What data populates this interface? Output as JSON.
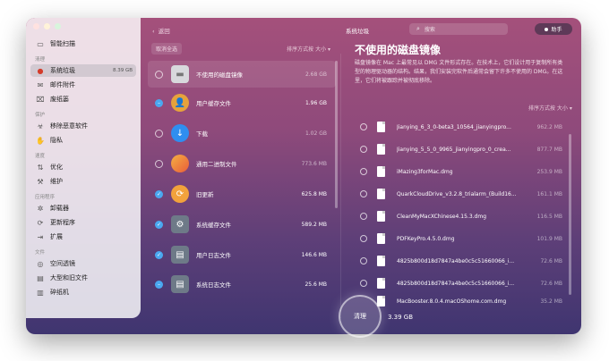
{
  "window": {
    "title": "系统垃圾",
    "back_label": "返回"
  },
  "search": {
    "placeholder": "搜索"
  },
  "assistant": {
    "label": "助手"
  },
  "sidebar": {
    "top_item": {
      "label": "智能扫描",
      "icon": "monitor-icon"
    },
    "sections": [
      {
        "label": "清理",
        "items": [
          {
            "label": "系统垃圾",
            "icon": "system-junk-icon",
            "size": "8.39 GB",
            "active": true
          },
          {
            "label": "邮件附件",
            "icon": "mail-icon"
          },
          {
            "label": "废纸篓",
            "icon": "trash-icon"
          }
        ]
      },
      {
        "label": "保护",
        "items": [
          {
            "label": "移除恶意软件",
            "icon": "biohazard-icon"
          },
          {
            "label": "隐私",
            "icon": "hand-icon"
          }
        ]
      },
      {
        "label": "速度",
        "items": [
          {
            "label": "优化",
            "icon": "sliders-icon"
          },
          {
            "label": "维护",
            "icon": "wrench-icon"
          }
        ]
      },
      {
        "label": "应用程序",
        "items": [
          {
            "label": "卸载器",
            "icon": "uninstaller-icon"
          },
          {
            "label": "更新程序",
            "icon": "updater-icon"
          },
          {
            "label": "扩展",
            "icon": "extensions-icon"
          }
        ]
      },
      {
        "label": "文件",
        "items": [
          {
            "label": "空间透镜",
            "icon": "space-lens-icon"
          },
          {
            "label": "大型和旧文件",
            "icon": "folder-icon"
          },
          {
            "label": "碎纸机",
            "icon": "shredder-icon"
          }
        ]
      }
    ]
  },
  "middle": {
    "select_all": "取消全选",
    "sort_label": "排序方式按 大小 ▾",
    "rows": [
      {
        "label": "不使用的磁盘镜像",
        "size": "2.68 GB",
        "check": "off",
        "icon": "disk-image-icon",
        "color": "#d8d8dc",
        "dim": true,
        "highlight": true
      },
      {
        "label": "用户缓存文件",
        "size": "1.96 GB",
        "check": "partial",
        "icon": "user-cache-icon",
        "color": "#e6a23c",
        "dim": false
      },
      {
        "label": "下载",
        "size": "1.02 GB",
        "check": "off",
        "icon": "download-icon",
        "color": "#2f8ef0",
        "dim": true
      },
      {
        "label": "通用二进制文件",
        "size": "773.6 MB",
        "check": "off",
        "icon": "universal-binary-icon",
        "color": "#f08a3a",
        "dim": true
      },
      {
        "label": "旧更新",
        "size": "625.8 MB",
        "check": "on",
        "icon": "old-updates-icon",
        "color": "#f2a23c",
        "dim": false
      },
      {
        "label": "系统缓存文件",
        "size": "589.2 MB",
        "check": "on",
        "icon": "system-cache-icon",
        "color": "#6e7a88",
        "dim": false
      },
      {
        "label": "用户日志文件",
        "size": "146.6 MB",
        "check": "on",
        "icon": "user-logs-icon",
        "color": "#6e7a88",
        "dim": false
      },
      {
        "label": "系统日志文件",
        "size": "25.6 MB",
        "check": "partial",
        "icon": "system-logs-icon",
        "color": "#6e7a88",
        "dim": false
      }
    ]
  },
  "detail": {
    "title": "不使用的磁盘镜像",
    "description": "磁盘镜像在 Mac 上最常见以 DMG 文件形式存在。在技术上，它们设计用于复制所有类型的物理驱动器的结构。结果，我们安装完软件后通常会留下许多不使用的 DMG。在这里，它们将被跟踪并被彻底移除。",
    "sort_label": "排序方式按 大小 ▾",
    "files": [
      {
        "name": "Jianying_6_3_0-beta3_10564_jianyingpro...",
        "size": "962.2 MB"
      },
      {
        "name": "Jianying_5_5_0_9965_jianyingpro_0_crea...",
        "size": "877.7 MB"
      },
      {
        "name": "iMazing3forMac.dmg",
        "size": "253.9 MB"
      },
      {
        "name": "QuarkCloudDrive_v3.2.8_trialarm_(Build16...",
        "size": "161.1 MB"
      },
      {
        "name": "CleanMyMacXChinese4.15.3.dmg",
        "size": "116.5 MB"
      },
      {
        "name": "PDFKeyPro.4.5.0.dmg",
        "size": "101.9 MB"
      },
      {
        "name": "4825b800d18d7847a4be0c5c51660066_i...",
        "size": "72.6 MB"
      },
      {
        "name": "4825b800d18d7847a4be0c5c51660066_i...",
        "size": "72.6 MB"
      },
      {
        "name": "MacBooster.8.0.4.macOShome.com.dmg",
        "size": "35.2 MB"
      }
    ]
  },
  "footer": {
    "clean_label": "清理",
    "total": "3.39 GB"
  },
  "colors": {
    "check_blue": "#4aa8f0",
    "gradient_top": "#a4507b",
    "gradient_bottom": "#3f3570"
  }
}
